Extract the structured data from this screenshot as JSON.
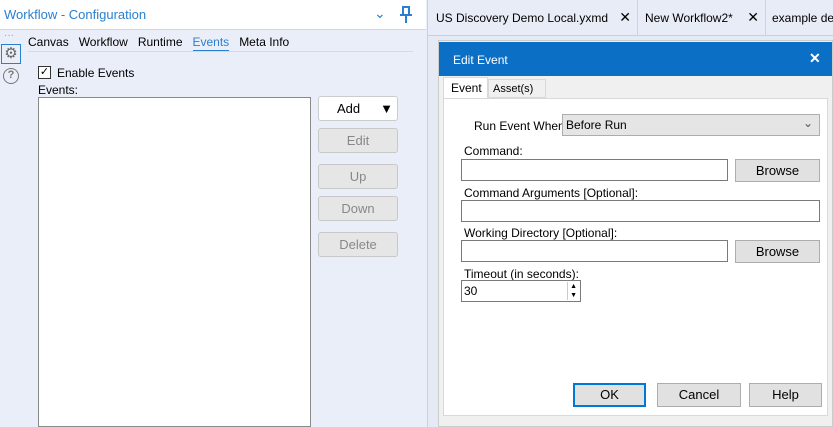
{
  "left_panel": {
    "title": "Workflow - Configuration",
    "tabs": [
      "Canvas",
      "Workflow",
      "Runtime",
      "Events",
      "Meta Info"
    ],
    "active_tab": "Events",
    "enable_events_label": "Enable Events",
    "enable_events_checked": true,
    "events_label": "Events:",
    "buttons": {
      "add": "Add",
      "edit": "Edit",
      "up": "Up",
      "down": "Down",
      "delete": "Delete"
    }
  },
  "doc_tabs": [
    {
      "label": "US Discovery Demo Local.yxmd"
    },
    {
      "label": "New Workflow2*"
    },
    {
      "label": "example de"
    }
  ],
  "dialog": {
    "title": "Edit Event",
    "tabs": [
      "Event",
      "Asset(s)"
    ],
    "run_event_label": "Run Event When:",
    "run_event_value": "Before Run",
    "command_label": "Command:",
    "command_value": "",
    "browse": "Browse",
    "args_label": "Command Arguments [Optional]:",
    "args_value": "",
    "workdir_label": "Working Directory [Optional]:",
    "workdir_value": "",
    "timeout_label": "Timeout (in seconds):",
    "timeout_value": "30",
    "ok": "OK",
    "cancel": "Cancel",
    "help": "Help"
  },
  "colors": {
    "accent": "#2a7fd0",
    "titlebar": "#0b6fc6"
  }
}
